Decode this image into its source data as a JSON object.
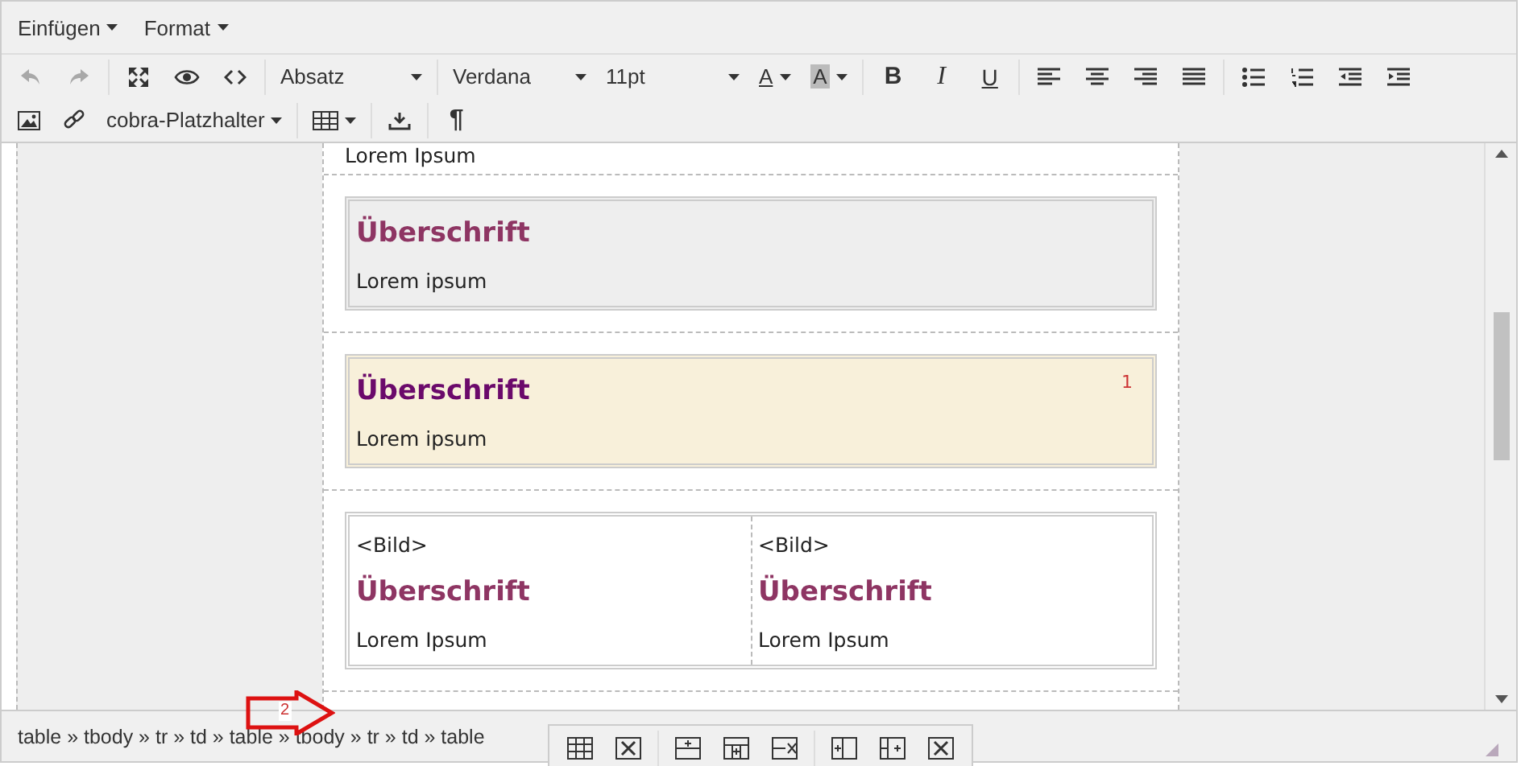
{
  "menu": [
    {
      "label": "Einfügen"
    },
    {
      "label": "Format"
    }
  ],
  "toolbar": {
    "undo": {
      "disabled": true
    },
    "redo": {
      "disabled": true
    },
    "block_format": "Absatz",
    "font_family": "Verdana",
    "font_size": "11pt",
    "text_color_glyph": "A",
    "background_color_glyph": "A",
    "bold": "B",
    "italic": "I",
    "underline": "U",
    "placeholder_menu": "cobra-Platzhalter",
    "pilcrow": "¶"
  },
  "content": [
    {
      "kind": "text",
      "text": "Lorem Ipsum"
    },
    {
      "kind": "box",
      "color": "#eeeeee",
      "heading": "Überschrift",
      "text": "Lorem ipsum"
    },
    {
      "kind": "highlight",
      "color": "#f8f0da",
      "heading": "Überschrift",
      "text": "Lorem ipsum",
      "marker": "1"
    },
    {
      "kind": "columns",
      "cells": [
        {
          "image": "<Bild>",
          "heading": "Überschrift",
          "text": "Lorem Ipsum",
          "color": "#8e3563"
        },
        {
          "image": "<Bild>",
          "heading": "Überschrift",
          "text": "Lorem Ipsum",
          "color": "#8e3563"
        }
      ]
    }
  ],
  "status_bar": {
    "path": "table » tbody » tr » td » table » tbody » tr » td » table"
  },
  "annotation": {
    "label": "2"
  }
}
